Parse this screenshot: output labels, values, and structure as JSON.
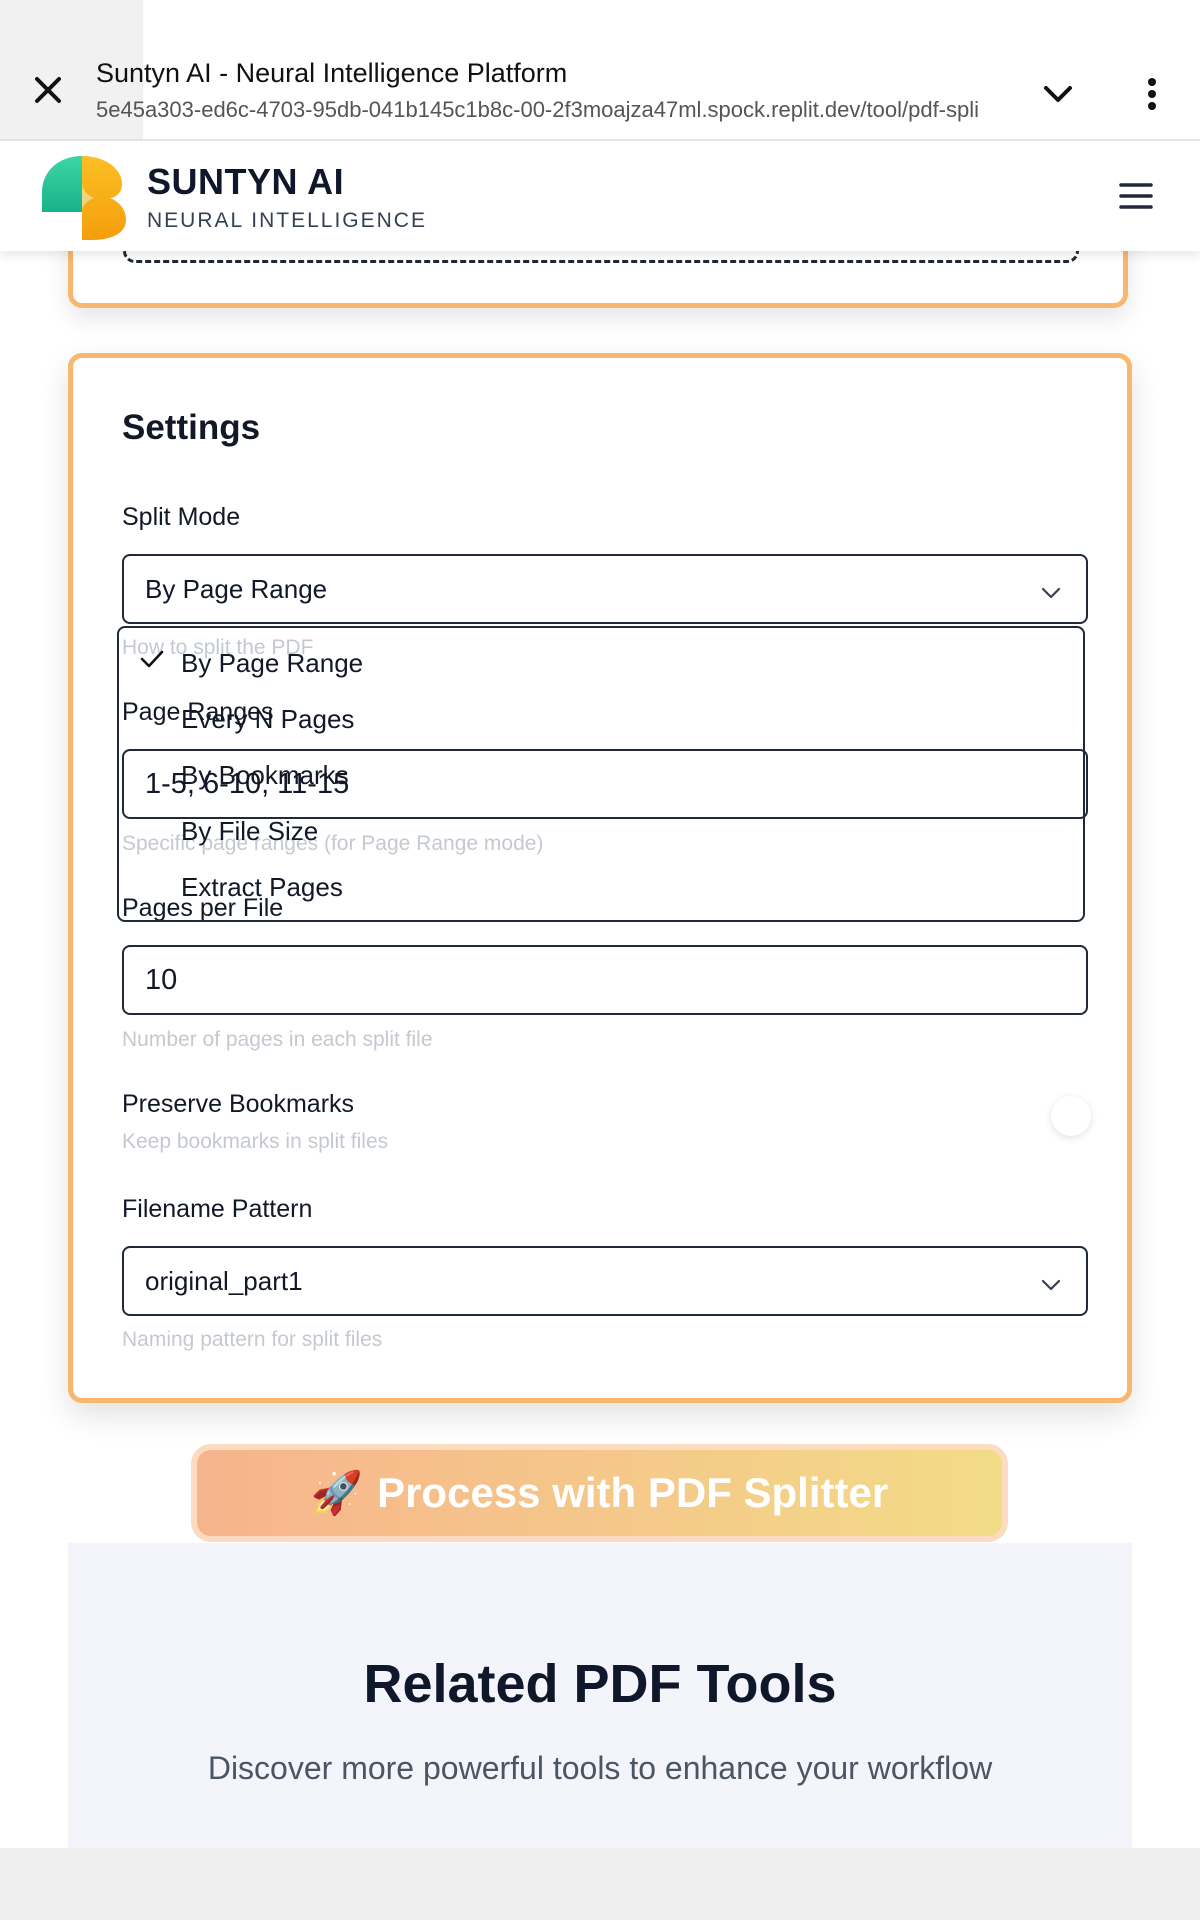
{
  "browser": {
    "title": "Suntyn AI - Neural Intelligence Platform",
    "url": "5e45a303-ed6c-4703-95db-041b145c1b8c-00-2f3moajza47ml.spock.replit.dev/tool/pdf-spli",
    "icons": {
      "close": "close-icon",
      "expand": "chevron-down-icon",
      "menu": "more-vertical-icon"
    }
  },
  "header": {
    "brand": "SUNTYN AI",
    "tagline": "NEURAL INTELLIGENCE",
    "menu_icon": "hamburger-icon"
  },
  "settings": {
    "title": "Settings",
    "split_mode": {
      "label": "Split Mode",
      "value": "By Page Range",
      "hint": "How to split the PDF",
      "options": [
        "By Page Range",
        "Every N Pages",
        "By Bookmarks",
        "By File Size",
        "Extract Pages"
      ],
      "selected_index": 0
    },
    "page_ranges": {
      "label": "Page Ranges",
      "value": "1-5, 6-10, 11-15",
      "hint": "Specific page ranges (for Page Range mode)"
    },
    "pages_per_file": {
      "label": "Pages per File",
      "value": "10",
      "hint": "Number of pages in each split file"
    },
    "preserve_bookmarks": {
      "label": "Preserve Bookmarks",
      "hint": "Keep bookmarks in split files"
    },
    "filename_pattern": {
      "label": "Filename Pattern",
      "value": "original_part1",
      "hint": "Naming pattern for split files"
    }
  },
  "process_button": {
    "emoji": "🚀",
    "label": "Process with PDF Splitter"
  },
  "related": {
    "title": "Related PDF Tools",
    "subtitle": "Discover more powerful tools to enhance your workflow"
  },
  "colors": {
    "accent_border": "#f7b76f",
    "button_start": "#f6b48c",
    "button_end": "#f2dc86"
  }
}
